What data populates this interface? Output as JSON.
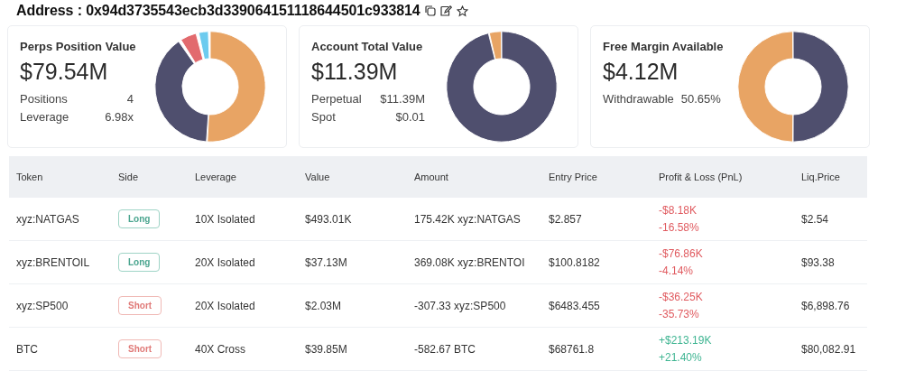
{
  "address": {
    "label": "Address : 0x94d3735543ecb3d339064151118644501c933814"
  },
  "cards": [
    {
      "title": "Perps Position Value",
      "value": "$79.54M",
      "stats": [
        {
          "label": "Positions",
          "value": "4"
        },
        {
          "label": "Leverage",
          "value": "6.98x"
        }
      ]
    },
    {
      "title": "Account Total Value",
      "value": "$11.39M",
      "stats": [
        {
          "label": "Perpetual",
          "value": "$11.39M"
        },
        {
          "label": "Spot",
          "value": "$0.01"
        }
      ]
    },
    {
      "title": "Free Margin Available",
      "value": "$4.12M",
      "stats": [
        {
          "label": "Withdrawable",
          "value": "50.65%"
        }
      ]
    }
  ],
  "table": {
    "columns": [
      "Token",
      "Side",
      "Leverage",
      "Value",
      "Amount",
      "Entry Price",
      "Profit & Loss (PnL)",
      "Liq.Price"
    ],
    "rows": [
      {
        "token": "xyz:NATGAS",
        "side": {
          "kind": "long",
          "label": "Long"
        },
        "leverage": "10X Isolated",
        "value": "$493.01K",
        "amount": "175.42K xyz:NATGAS",
        "entry": "$2.857",
        "pnl": {
          "kind": "loss",
          "amount": "-$8.18K",
          "percent": "-16.58%"
        },
        "liq": "$2.54"
      },
      {
        "token": "xyz:BRENTOIL",
        "side": {
          "kind": "long",
          "label": "Long"
        },
        "leverage": "20X Isolated",
        "value": "$37.13M",
        "amount": "369.08K xyz:BRENTOI",
        "entry": "$100.8182",
        "pnl": {
          "kind": "loss",
          "amount": "-$76.86K",
          "percent": "-4.14%"
        },
        "liq": "$93.38"
      },
      {
        "token": "xyz:SP500",
        "side": {
          "kind": "short",
          "label": "Short"
        },
        "leverage": "20X Isolated",
        "value": "$2.03M",
        "amount": "-307.33 xyz:SP500",
        "entry": "$6483.455",
        "pnl": {
          "kind": "loss",
          "amount": "-$36.25K",
          "percent": "-35.73%"
        },
        "liq": "$6,898.76"
      },
      {
        "token": "BTC",
        "side": {
          "kind": "short",
          "label": "Short"
        },
        "leverage": "40X Cross",
        "value": "$39.85M",
        "amount": "-582.67 BTC",
        "entry": "$68761.8",
        "pnl": {
          "kind": "profit",
          "amount": "+$213.19K",
          "percent": "+21.40%"
        },
        "liq": "$80,082.91"
      }
    ]
  }
}
